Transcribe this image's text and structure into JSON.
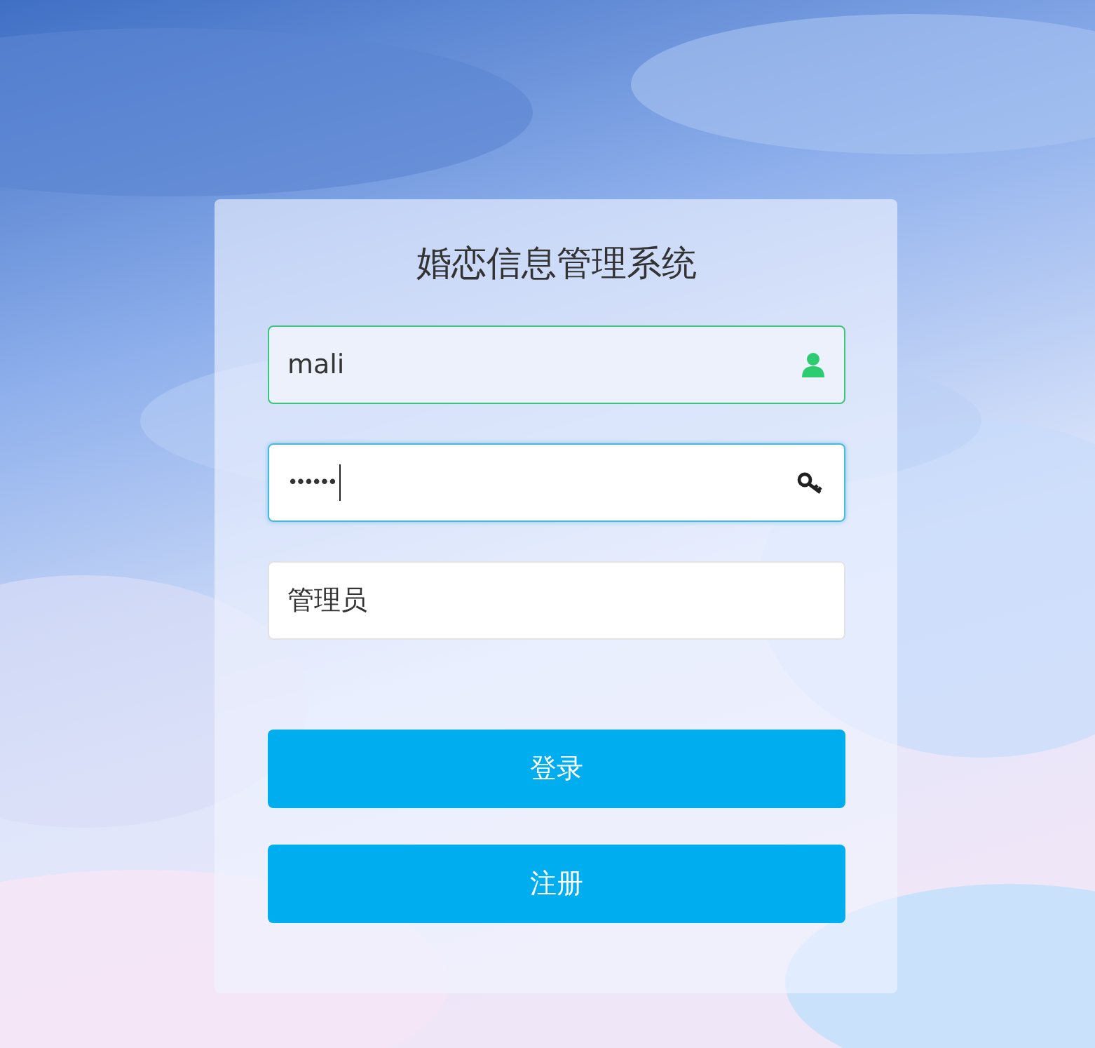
{
  "login_form": {
    "title": "婚恋信息管理系统",
    "fields": [
      {
        "kind": "text",
        "value": "mali",
        "valid": true,
        "focused": false
      },
      {
        "kind": "password",
        "value": "••••••",
        "valid": false,
        "focused": true
      },
      {
        "kind": "text",
        "value": "管理员",
        "valid": false,
        "focused": false
      }
    ],
    "buttons": [
      {
        "label": "登录"
      },
      {
        "label": "注册"
      }
    ]
  }
}
